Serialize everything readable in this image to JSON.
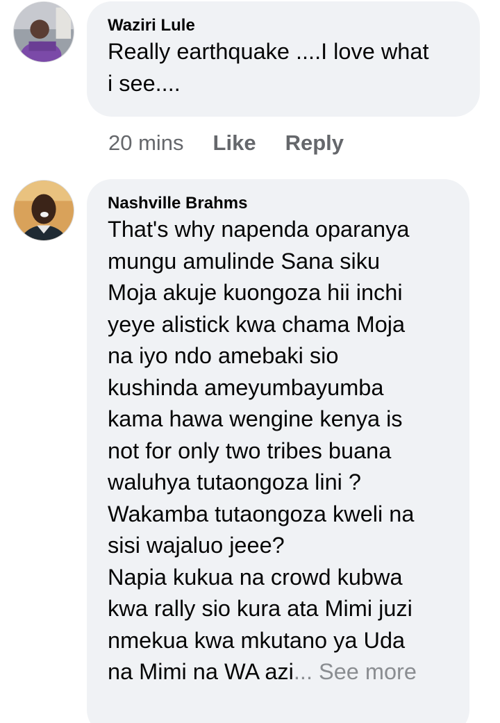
{
  "comments": [
    {
      "author": "Waziri Lule",
      "text": "Really earthquake ....I love what\ni see....",
      "time": "20 mins",
      "like_label": "Like",
      "reply_label": "Reply"
    },
    {
      "author": "Nashville Brahms",
      "text": "That's why napenda oparanya\nmungu amulinde Sana siku\nMoja akuje kuongoza hii inchi\nyeye alistick kwa chama Moja\nna iyo ndo amebaki sio\nkushinda ameyumbayumba\nkama hawa wengine kenya is\nnot for only two tribes buana\nwaluhya tutaongoza lini ?\nWakamba tutaongoza kweli na\nsisi wajaluo jeee?\nNapia kukua na crowd kubwa\nkwa rally sio kura ata Mimi juzi\nnmekua kwa mkutano ya Uda\nna Mimi na WA azi",
      "see_more": "... See more"
    }
  ],
  "icons": {
    "avatar_1": "user-avatar-photo",
    "avatar_2": "user-avatar-photo"
  },
  "colors": {
    "bubble": "#f0f2f5",
    "meta_text": "#65676b",
    "see_more": "#8a8d91"
  }
}
